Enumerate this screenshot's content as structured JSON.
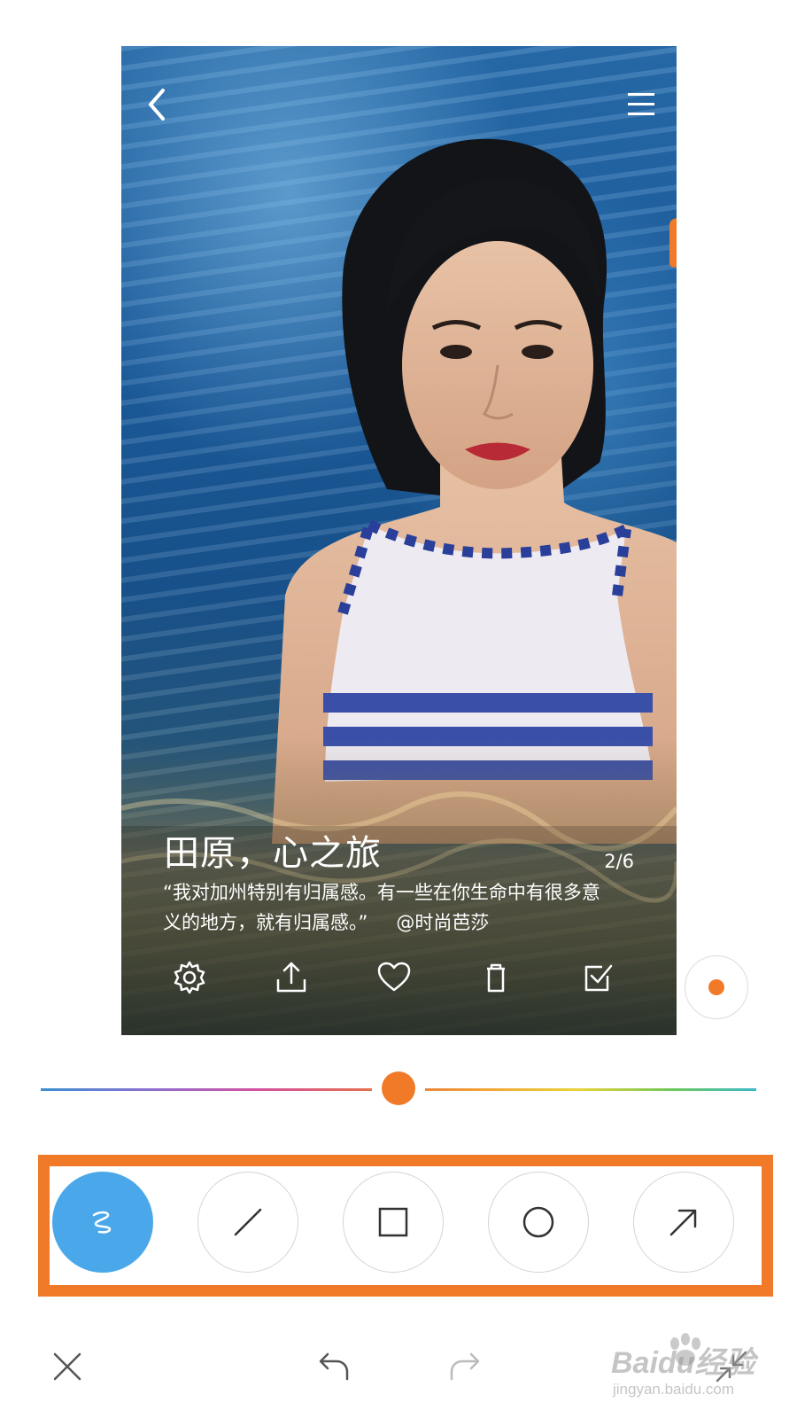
{
  "photo": {
    "title": "田原，心之旅",
    "page_counter": "2/6",
    "quote_line1": "“我对加州特别有归属感。有一些在你生命中有很多意",
    "quote_line2": "义的地方，就有归属感。”",
    "quote_source": "@时尚芭莎"
  },
  "icons": {
    "back": "chevron-left-icon",
    "menu": "hamburger-menu-icon",
    "settings": "gear-icon",
    "share": "share-upload-icon",
    "like": "heart-icon",
    "delete": "trash-icon",
    "select": "checkbox-icon",
    "record": "record-dot-icon",
    "close": "close-icon",
    "undo": "undo-icon",
    "redo": "redo-icon",
    "collapse": "collapse-arrows-icon"
  },
  "brush_size": {
    "value_fraction": 0.5
  },
  "tools": [
    {
      "name": "freehand",
      "icon": "scribble-icon",
      "active": true
    },
    {
      "name": "line",
      "icon": "line-icon",
      "active": false
    },
    {
      "name": "rectangle",
      "icon": "square-icon",
      "active": false
    },
    {
      "name": "circle",
      "icon": "circle-icon",
      "active": false
    },
    {
      "name": "arrow",
      "icon": "arrow-icon",
      "active": false
    }
  ],
  "colors": {
    "accent": "#f07a28",
    "active_tool": "#4aa8ea"
  },
  "watermark": {
    "brand": "Baidu经验",
    "site": "jingyan.baidu.com"
  }
}
